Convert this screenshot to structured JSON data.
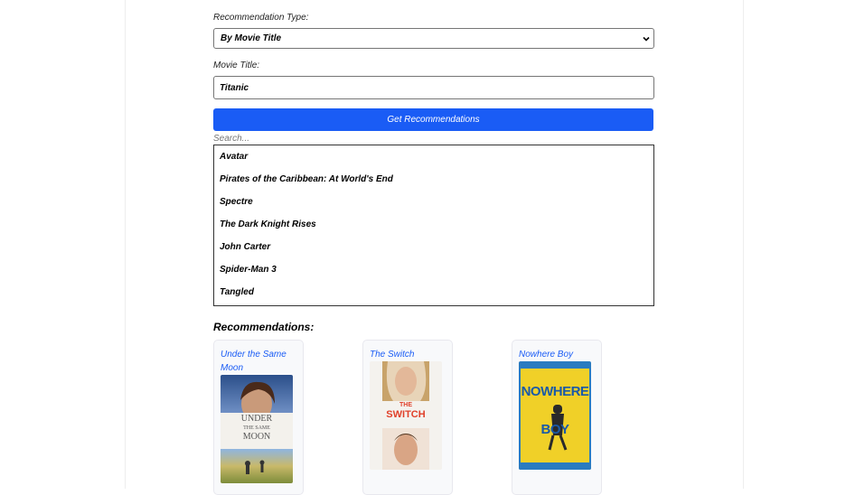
{
  "form": {
    "type_label": "Recommendation Type:",
    "type_value": "By Movie Title",
    "title_label": "Movie Title:",
    "title_value": "Titanic",
    "button_label": "Get Recommendations",
    "search_placeholder": "Search..."
  },
  "movies": [
    "Avatar",
    "Pirates of the Caribbean: At World's End",
    "Spectre",
    "The Dark Knight Rises",
    "John Carter",
    "Spider-Man 3",
    "Tangled"
  ],
  "recommendations": {
    "heading": "Recommendations:",
    "items": [
      {
        "title": "Under the Same Moon",
        "poster_text": [
          "UNDER",
          "THE SAME",
          "MOON"
        ]
      },
      {
        "title": "The Switch",
        "poster_text": [
          "THE",
          "SWITCH"
        ]
      },
      {
        "title": "Nowhere Boy",
        "poster_text": [
          "NOWHERE",
          "BOY"
        ]
      }
    ]
  },
  "colors": {
    "accent": "#1a5cf5",
    "link": "#1a5cf5"
  }
}
